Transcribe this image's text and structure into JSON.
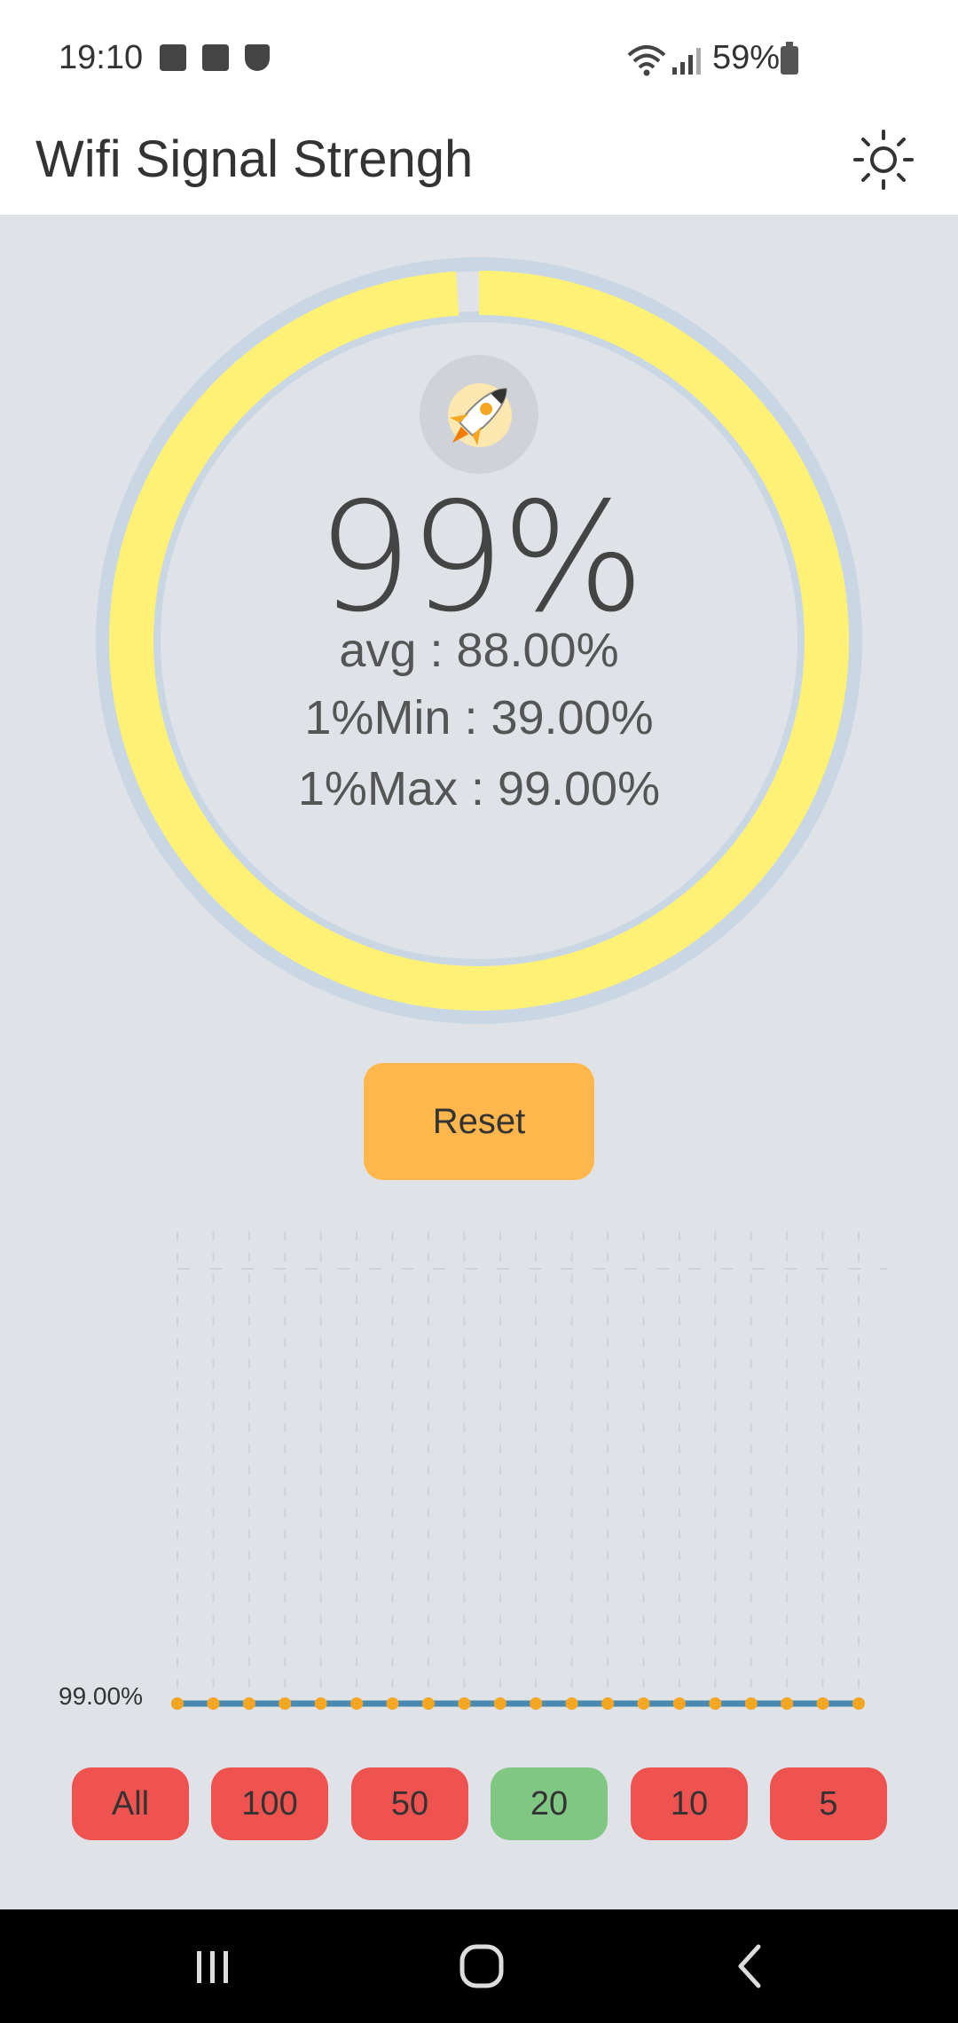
{
  "status_bar": {
    "time": "19:10",
    "battery": "59%",
    "left_icons": [
      "image-icon",
      "clock-app-icon",
      "shield-icon"
    ],
    "right_icons": [
      "wifi-icon",
      "cellular-signal-icon",
      "battery-icon"
    ]
  },
  "app_bar": {
    "title": "Wifi Signal Strengh",
    "theme_icon": "sun-icon"
  },
  "gauge": {
    "value_text": "99%",
    "fill_fraction": 0.99,
    "avg": "avg : 88.00%",
    "min": "1%Min : 39.00%",
    "max": "1%Max : 99.00%",
    "icon": "rocket-icon",
    "colors": {
      "ring": "#fff176",
      "track": "#c8d7e3"
    }
  },
  "reset_label": "Reset",
  "chart_data": {
    "type": "line",
    "title": "",
    "xlabel": "",
    "ylabel": "",
    "value_label": "99.00%",
    "x": [
      1,
      2,
      3,
      4,
      5,
      6,
      7,
      8,
      9,
      10,
      11,
      12,
      13,
      14,
      15,
      16,
      17,
      18,
      19,
      20
    ],
    "series": [
      {
        "values": [
          99,
          99,
          99,
          99,
          99,
          99,
          99,
          99,
          99,
          99,
          99,
          99,
          99,
          99,
          99,
          99,
          99,
          99,
          99,
          99
        ]
      }
    ],
    "grid": true,
    "colors": {
      "line": "#4a8ab0",
      "point": "#f5a623"
    }
  },
  "range_buttons": [
    "All",
    "100",
    "50",
    "20",
    "10",
    "5"
  ],
  "selected_range": "20",
  "range_colors": {
    "default": "#ef5350",
    "selected": "#81c784"
  },
  "nav_bar": {
    "icons": [
      "recent-apps-icon",
      "home-icon",
      "back-icon"
    ]
  }
}
